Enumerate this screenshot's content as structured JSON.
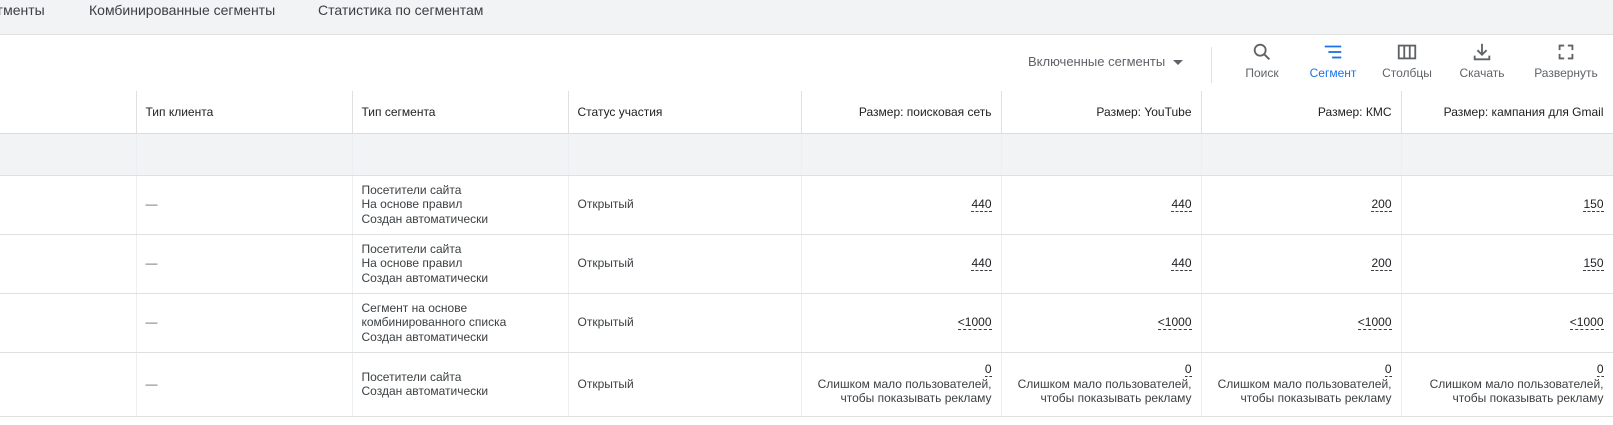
{
  "tabs": [
    "гменты",
    "Комбинированные сегменты",
    "Статистика по сегментам"
  ],
  "toolbar": {
    "filter_label": "Включенные сегменты",
    "buttons": [
      {
        "label": "Поиск",
        "icon": "search-icon",
        "active": false
      },
      {
        "label": "Сегмент",
        "icon": "segment-icon",
        "active": true
      },
      {
        "label": "Столбцы",
        "icon": "columns-icon",
        "active": false
      },
      {
        "label": "Скачать",
        "icon": "download-icon",
        "active": false
      },
      {
        "label": "Развернуть",
        "icon": "fullscreen-icon",
        "active": false
      }
    ],
    "accent_color": "#1a73e8"
  },
  "table": {
    "headers": [
      "",
      "Тип клиента",
      "Тип сегмента",
      "Статус участия",
      "Размер: поисковая сеть",
      "Размер: YouTube",
      "Размер: КМС",
      "Размер: кампания для Gmail"
    ],
    "rows": [
      {
        "client": "—",
        "segment": [
          "Посетители сайта",
          "На основе правил",
          "Создан автоматически"
        ],
        "status": "Открытый",
        "sizes": [
          "440",
          "440",
          "200",
          "150"
        ],
        "note": [
          "",
          ""
        ]
      },
      {
        "client": "—",
        "segment": [
          "Посетители сайта",
          "На основе правил",
          "Создан автоматически"
        ],
        "status": "Открытый",
        "sizes": [
          "440",
          "440",
          "200",
          "150"
        ],
        "note": [
          "",
          ""
        ]
      },
      {
        "client": "—",
        "segment": [
          "Сегмент на основе",
          "комбинированного списка",
          "Создан автоматически"
        ],
        "status": "Открытый",
        "sizes": [
          "<1000",
          "<1000",
          "<1000",
          "<1000"
        ],
        "note": [
          "",
          ""
        ]
      },
      {
        "client": "—",
        "segment": [
          "Посетители сайта",
          "Создан автоматически",
          ""
        ],
        "status": "Открытый",
        "sizes": [
          "0",
          "0",
          "0",
          "0"
        ],
        "note": [
          "Слишком мало пользователей,",
          "чтобы показывать рекламу"
        ]
      }
    ]
  }
}
